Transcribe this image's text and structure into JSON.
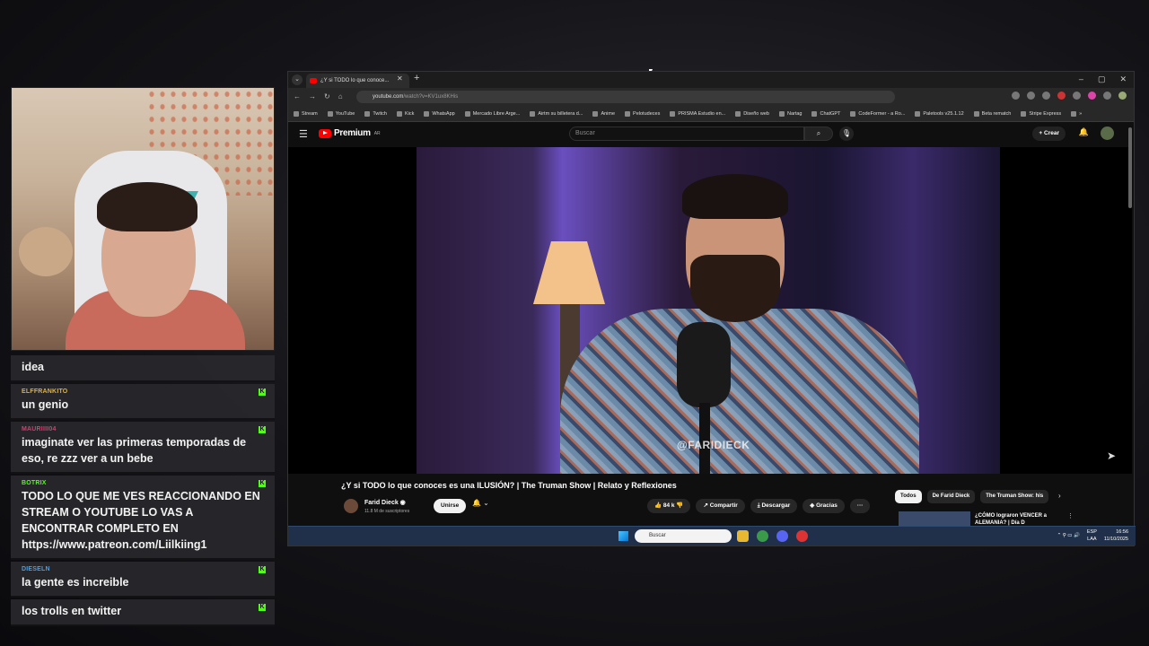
{
  "chat": [
    {
      "user": "",
      "text": "idea",
      "color": "#ffffff"
    },
    {
      "user": "ELFFRANKITO",
      "text": "un genio",
      "color": "#e0b040"
    },
    {
      "user": "MAURIIII04",
      "text": "imaginate ver las primeras temporadas de eso, re zzz ver a un bebe",
      "color": "#d04070"
    },
    {
      "user": "BOTRIX",
      "text": "TODO LO QUE ME VES REACCIONANDO EN STREAM O YOUTUBE LO VAS A ENCONTRAR COMPLETO EN https://www.patreon.com/Liilkiing1",
      "color": "#53fc18"
    },
    {
      "user": "DIESELN",
      "text": "la gente es increible",
      "color": "#4aa0e0"
    },
    {
      "user": "",
      "text": "los trolls en twitter",
      "color": "#e03030"
    }
  ],
  "browser": {
    "tab_title": "¿Y si TODO lo que conoce...",
    "tab_close": "✕",
    "tab_new": "+",
    "tab_menu": "⌄",
    "window_controls": [
      "–",
      "▢",
      "✕"
    ],
    "nav": [
      "←",
      "→",
      "↻",
      "⌂"
    ],
    "url_main": "youtube.com",
    "url_rest": "/watch?v=KV1ux8KHis",
    "bookmarks": [
      "Stream",
      "YouTube",
      "Twitch",
      "Kick",
      "WhatsApp",
      "Mercado Libre Arge...",
      "Airtm su billetera d...",
      "Anime",
      "Pelotudeces",
      "PRISMA Estudio en...",
      "Diseño web",
      "Nartag",
      "ChatGPT",
      "CodeFormer - a Ro...",
      "Paletools v25.1.12",
      "Beta rematch",
      "Stripe Express",
      "»"
    ]
  },
  "youtube": {
    "menu_icon": "☰",
    "logo_word": "Premium",
    "logo_region": "AR",
    "search_placeholder": "Buscar",
    "search_icon": "⌕",
    "mic_icon": "🎙",
    "create_label": "+ Crear",
    "bell_icon": "🔔",
    "watermark": "@FARIDIECK",
    "next_icon": "➤",
    "video_title": "¿Y si TODO lo que conoces es una ILUSIÓN? | The Truman Show | Relato y Reflexiones",
    "channel_name": "Farid Dieck ◉",
    "channel_subs": "11.8 M de suscriptores",
    "join_label": "Unirse",
    "notify_icon": "🔔 ⌄",
    "likes": "👍 84 k",
    "dislike": "👎",
    "share": "↗ Compartir",
    "download": "⤓ Descargar",
    "thanks": "◈ Gracias",
    "more": "···",
    "chips": [
      "Todos",
      "De Farid Dieck",
      "The Truman Show: his"
    ],
    "chip_next": "›",
    "rec_title": "¿CÓMO lograron VENCER a ALEMANIA? | Día D",
    "rec_more": "⋮"
  },
  "taskbar": {
    "search_placeholder": "Buscar",
    "lang_top": "ESP",
    "lang_bottom": "LAA",
    "time": "16:56",
    "date": "11/10/2025",
    "tray_icons": "⌃  ⚲  ▭  🔊"
  }
}
